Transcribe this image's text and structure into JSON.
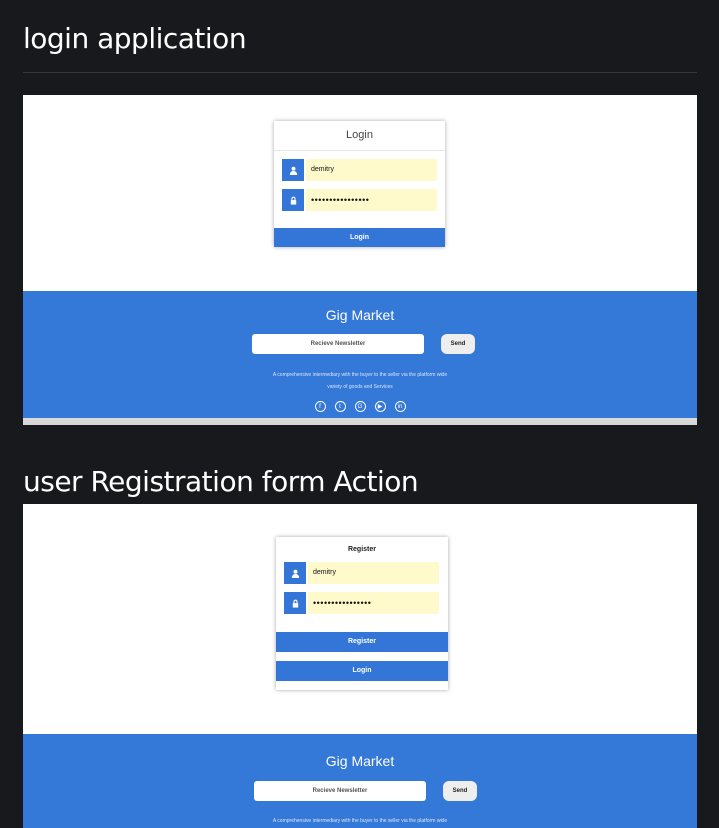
{
  "sections": [
    {
      "heading": "login application",
      "screenshot": {
        "card_title": "Login",
        "username": "demitry",
        "password": "••••••••••••••••",
        "login_button": "Login"
      }
    },
    {
      "heading": "user Registration form Action",
      "screenshot": {
        "card_title": "Register",
        "username": "demitry",
        "password": "••••••••••••••••",
        "register_button": "Register",
        "login_button": "Login"
      }
    }
  ],
  "footer": {
    "brand": "Gig Market",
    "newsletter_placeholder": "Recieve Newsletter",
    "send_label": "Send",
    "description_line1": "A comprehensive intermediary with the buyer to the seller via the platform wide",
    "description_line2": "variety of goods and Services",
    "social_icons": [
      "facebook-icon",
      "twitter-icon",
      "google-plus-icon",
      "youtube-icon",
      "linkedin-icon"
    ]
  },
  "colors": {
    "page_bg": "#18191d",
    "accent": "#3376d8",
    "field_bg": "#fffacb"
  }
}
